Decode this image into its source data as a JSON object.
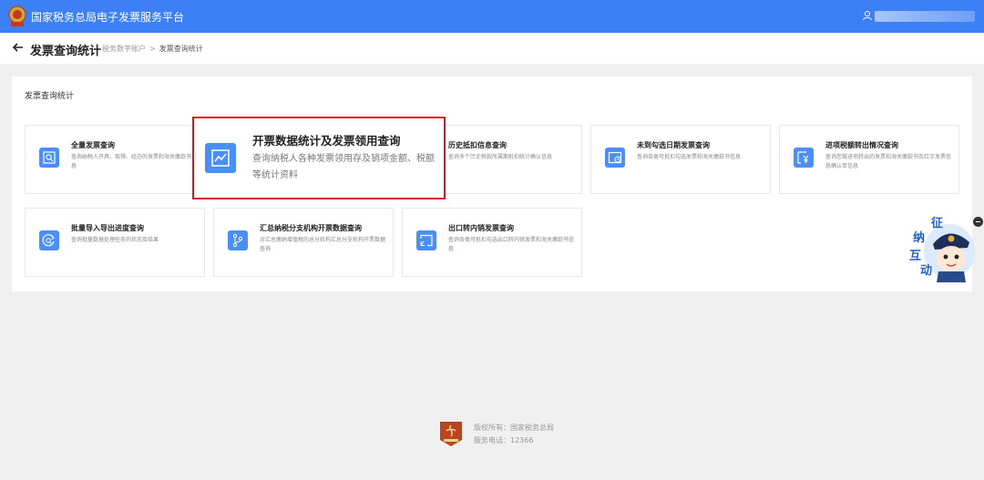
{
  "header": {
    "app_title": "国家税务总局电子发票服务平台",
    "user_name": ""
  },
  "subheader": {
    "page_title": "发票查询统计",
    "breadcrumb": [
      "税务数字账户",
      "发票查询统计"
    ],
    "breadcrumb_sep": ">"
  },
  "panel": {
    "title": "发票查询统计"
  },
  "cards": [
    {
      "title": "全量发票查询",
      "desc": "查询纳税人开具、取得、经办的发票和海关缴款书信息",
      "icon": "search-document-icon"
    },
    {
      "title": "历史抵扣信息查询",
      "desc": "查询多个历史税款所属期抵扣统计确认信息",
      "icon": "history-icon"
    },
    {
      "title": "未到勾选日期发票查询",
      "desc": "查询各类可抵扣勾选发票和海关缴款书信息",
      "icon": "calendar-clock-icon"
    },
    {
      "title": "进项税额转出情况查询",
      "desc": "查询您做进项转出的发票和海关缴款书及红字发票信息确认单信息",
      "icon": "yen-document-icon"
    },
    {
      "title": "批量导入导出进度查询",
      "desc": "查询批量数据处理任务的状态及结果",
      "icon": "refresh-search-icon"
    },
    {
      "title": "汇总纳税分支机构开票数据查询",
      "desc": "对汇总缴纳增值税的总分机构汇总分支机构开票数据查询",
      "icon": "branch-icon"
    },
    {
      "title": "出口转内销发票查询",
      "desc": "查询各类可抵扣勾选出口转内销发票和海关缴款书信息",
      "icon": "export-icon"
    }
  ],
  "highlight": {
    "title": "开票数据统计及发票领用查询",
    "desc": "查询纳税人各种发票领用存及销项金额、税额等统计资料",
    "icon": "chart-line-icon",
    "accent": "#e0161b"
  },
  "mascot": {
    "chars": [
      "征",
      "纳",
      "互",
      "动"
    ]
  },
  "footer": {
    "copyright": "版权所有：国家税务总局",
    "phone": "服务电话：12366"
  },
  "colors": {
    "topbar": "#3d7ff5",
    "icon_bg": "#4a8ef7",
    "page_bg": "#f0f0f0"
  }
}
